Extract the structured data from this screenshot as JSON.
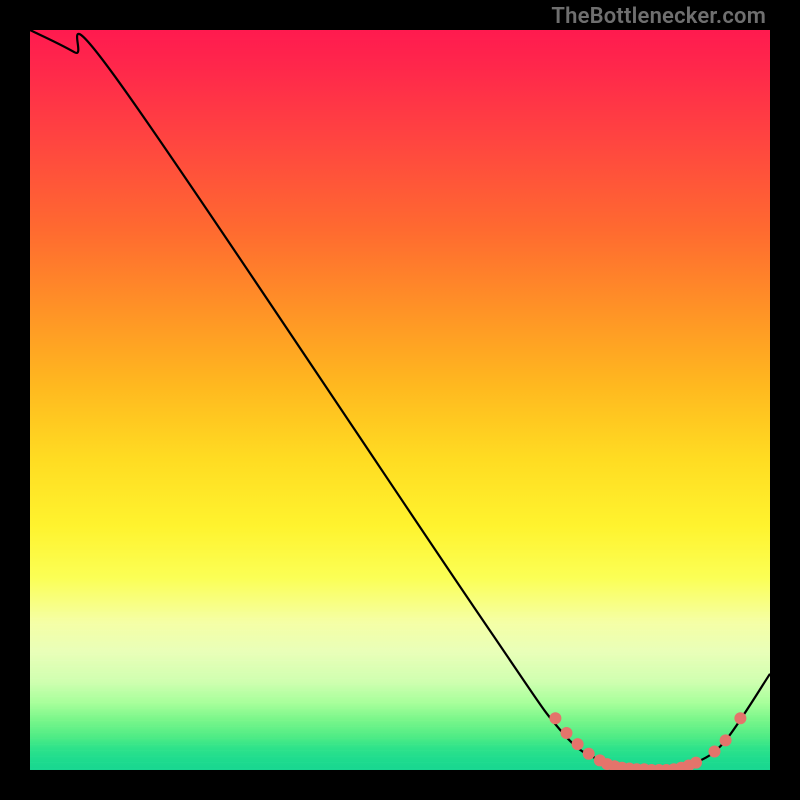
{
  "watermark": "TheBottlenecker.com",
  "colors": {
    "curve": "#000000",
    "dot_fill": "#e4746b",
    "dot_stroke": "#b6564f"
  },
  "chart_data": {
    "type": "line",
    "title": "",
    "xlabel": "",
    "ylabel": "",
    "xlim": [
      0,
      100
    ],
    "ylim": [
      0,
      100
    ],
    "series": [
      {
        "name": "curve",
        "x": [
          0,
          6,
          12,
          60,
          72,
          78,
          82,
          86,
          90,
          94,
          100
        ],
        "y": [
          100,
          97,
          93,
          22,
          5,
          1,
          0,
          0,
          1,
          4,
          13
        ]
      }
    ],
    "points": [
      {
        "x": 71,
        "y": 7
      },
      {
        "x": 72.5,
        "y": 5
      },
      {
        "x": 74,
        "y": 3.5
      },
      {
        "x": 75.5,
        "y": 2.2
      },
      {
        "x": 77,
        "y": 1.3
      },
      {
        "x": 78,
        "y": 0.8
      },
      {
        "x": 79,
        "y": 0.5
      },
      {
        "x": 80,
        "y": 0.3
      },
      {
        "x": 81,
        "y": 0.2
      },
      {
        "x": 82,
        "y": 0.1
      },
      {
        "x": 83,
        "y": 0.1
      },
      {
        "x": 84,
        "y": 0.0
      },
      {
        "x": 85,
        "y": 0.0
      },
      {
        "x": 86,
        "y": 0.0
      },
      {
        "x": 87,
        "y": 0.1
      },
      {
        "x": 88,
        "y": 0.3
      },
      {
        "x": 89,
        "y": 0.6
      },
      {
        "x": 90,
        "y": 1.0
      },
      {
        "x": 92.5,
        "y": 2.5
      },
      {
        "x": 94,
        "y": 4.0
      },
      {
        "x": 96,
        "y": 7.0
      }
    ]
  }
}
